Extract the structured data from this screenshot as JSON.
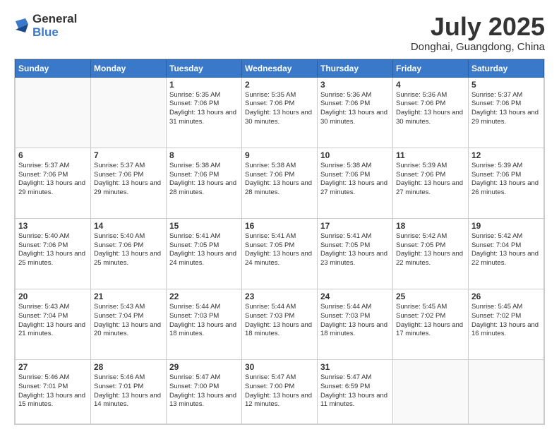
{
  "header": {
    "logo_general": "General",
    "logo_blue": "Blue",
    "month_title": "July 2025",
    "location": "Donghai, Guangdong, China"
  },
  "weekdays": [
    "Sunday",
    "Monday",
    "Tuesday",
    "Wednesday",
    "Thursday",
    "Friday",
    "Saturday"
  ],
  "weeks": [
    [
      {
        "day": "",
        "info": ""
      },
      {
        "day": "",
        "info": ""
      },
      {
        "day": "1",
        "info": "Sunrise: 5:35 AM\nSunset: 7:06 PM\nDaylight: 13 hours and 31 minutes."
      },
      {
        "day": "2",
        "info": "Sunrise: 5:35 AM\nSunset: 7:06 PM\nDaylight: 13 hours and 30 minutes."
      },
      {
        "day": "3",
        "info": "Sunrise: 5:36 AM\nSunset: 7:06 PM\nDaylight: 13 hours and 30 minutes."
      },
      {
        "day": "4",
        "info": "Sunrise: 5:36 AM\nSunset: 7:06 PM\nDaylight: 13 hours and 30 minutes."
      },
      {
        "day": "5",
        "info": "Sunrise: 5:37 AM\nSunset: 7:06 PM\nDaylight: 13 hours and 29 minutes."
      }
    ],
    [
      {
        "day": "6",
        "info": "Sunrise: 5:37 AM\nSunset: 7:06 PM\nDaylight: 13 hours and 29 minutes."
      },
      {
        "day": "7",
        "info": "Sunrise: 5:37 AM\nSunset: 7:06 PM\nDaylight: 13 hours and 29 minutes."
      },
      {
        "day": "8",
        "info": "Sunrise: 5:38 AM\nSunset: 7:06 PM\nDaylight: 13 hours and 28 minutes."
      },
      {
        "day": "9",
        "info": "Sunrise: 5:38 AM\nSunset: 7:06 PM\nDaylight: 13 hours and 28 minutes."
      },
      {
        "day": "10",
        "info": "Sunrise: 5:38 AM\nSunset: 7:06 PM\nDaylight: 13 hours and 27 minutes."
      },
      {
        "day": "11",
        "info": "Sunrise: 5:39 AM\nSunset: 7:06 PM\nDaylight: 13 hours and 27 minutes."
      },
      {
        "day": "12",
        "info": "Sunrise: 5:39 AM\nSunset: 7:06 PM\nDaylight: 13 hours and 26 minutes."
      }
    ],
    [
      {
        "day": "13",
        "info": "Sunrise: 5:40 AM\nSunset: 7:06 PM\nDaylight: 13 hours and 25 minutes."
      },
      {
        "day": "14",
        "info": "Sunrise: 5:40 AM\nSunset: 7:06 PM\nDaylight: 13 hours and 25 minutes."
      },
      {
        "day": "15",
        "info": "Sunrise: 5:41 AM\nSunset: 7:05 PM\nDaylight: 13 hours and 24 minutes."
      },
      {
        "day": "16",
        "info": "Sunrise: 5:41 AM\nSunset: 7:05 PM\nDaylight: 13 hours and 24 minutes."
      },
      {
        "day": "17",
        "info": "Sunrise: 5:41 AM\nSunset: 7:05 PM\nDaylight: 13 hours and 23 minutes."
      },
      {
        "day": "18",
        "info": "Sunrise: 5:42 AM\nSunset: 7:05 PM\nDaylight: 13 hours and 22 minutes."
      },
      {
        "day": "19",
        "info": "Sunrise: 5:42 AM\nSunset: 7:04 PM\nDaylight: 13 hours and 22 minutes."
      }
    ],
    [
      {
        "day": "20",
        "info": "Sunrise: 5:43 AM\nSunset: 7:04 PM\nDaylight: 13 hours and 21 minutes."
      },
      {
        "day": "21",
        "info": "Sunrise: 5:43 AM\nSunset: 7:04 PM\nDaylight: 13 hours and 20 minutes."
      },
      {
        "day": "22",
        "info": "Sunrise: 5:44 AM\nSunset: 7:03 PM\nDaylight: 13 hours and 18 minutes."
      },
      {
        "day": "23",
        "info": "Sunrise: 5:44 AM\nSunset: 7:03 PM\nDaylight: 13 hours and 18 minutes."
      },
      {
        "day": "24",
        "info": "Sunrise: 5:44 AM\nSunset: 7:03 PM\nDaylight: 13 hours and 18 minutes."
      },
      {
        "day": "25",
        "info": "Sunrise: 5:45 AM\nSunset: 7:02 PM\nDaylight: 13 hours and 17 minutes."
      },
      {
        "day": "26",
        "info": "Sunrise: 5:45 AM\nSunset: 7:02 PM\nDaylight: 13 hours and 16 minutes."
      }
    ],
    [
      {
        "day": "27",
        "info": "Sunrise: 5:46 AM\nSunset: 7:01 PM\nDaylight: 13 hours and 15 minutes."
      },
      {
        "day": "28",
        "info": "Sunrise: 5:46 AM\nSunset: 7:01 PM\nDaylight: 13 hours and 14 minutes."
      },
      {
        "day": "29",
        "info": "Sunrise: 5:47 AM\nSunset: 7:00 PM\nDaylight: 13 hours and 13 minutes."
      },
      {
        "day": "30",
        "info": "Sunrise: 5:47 AM\nSunset: 7:00 PM\nDaylight: 13 hours and 12 minutes."
      },
      {
        "day": "31",
        "info": "Sunrise: 5:47 AM\nSunset: 6:59 PM\nDaylight: 13 hours and 11 minutes."
      },
      {
        "day": "",
        "info": ""
      },
      {
        "day": "",
        "info": ""
      }
    ]
  ]
}
